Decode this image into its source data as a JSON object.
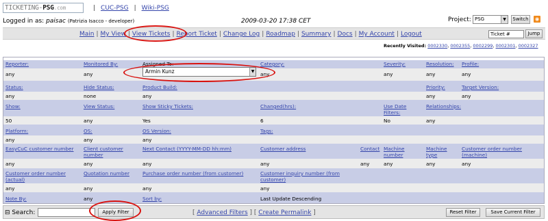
{
  "header": {
    "logo": {
      "prefix": "TICKETING-",
      "brand": "PSG",
      "suffix": ".com"
    },
    "top_links": [
      "CUC-PSG",
      "Wiki-PSG"
    ],
    "logged_in_label": "Logged in as:",
    "user": "paisac",
    "user_detail": "(Patrizia Isacco - developer)",
    "datetime": "2009-03-20 17:38 CET",
    "project_label": "Project:",
    "project_value": "PSG",
    "switch_label": "Switch"
  },
  "nav": {
    "items": [
      "Main",
      "My View",
      "View Tickets",
      "Report Ticket",
      "Change Log",
      "Roadmap",
      "Summary",
      "Docs",
      "My Account",
      "Logout"
    ],
    "ticket_placeholder": "Ticket #",
    "jump_label": "Jump"
  },
  "recent": {
    "label": "Recently Visited:",
    "items": [
      "0002330",
      "0002355",
      "0002299",
      "0002301",
      "0002327"
    ]
  },
  "filters": {
    "r1h": [
      "Reporter:",
      "Monitored By:",
      "Assigned To:",
      "Category:",
      "Severity:",
      "Resolution:",
      "Profile:"
    ],
    "r1v": [
      "any",
      "any",
      "any",
      "any",
      "any",
      "any"
    ],
    "assigned_value": "Armin Kunz",
    "r2h": [
      "Status:",
      "Hide Status:",
      "Product Build:",
      "Priority:",
      "Target Version:"
    ],
    "r2v": [
      "any",
      "none",
      "any",
      "any",
      "any"
    ],
    "r3h": [
      "Show:",
      "View Status:",
      "Show Sticky Tickets:",
      "Changed(hrs):",
      "Use Date Filters:",
      "Relationships:"
    ],
    "r3v": [
      "50",
      "any",
      "Yes",
      "6",
      "No",
      "any"
    ],
    "r4h": [
      "Platform:",
      "OS:",
      "OS Version:",
      "Tags:"
    ],
    "r4v": [
      "any",
      "any",
      "any"
    ],
    "r5h": [
      "EasyCuC customer number",
      "Client customer number",
      "Next Contact (YYYY-MM-DD hh:mm)",
      "Customer address",
      "Contact",
      "Machine number",
      "Machine type",
      "Customer order number (machine)"
    ],
    "r5v": [
      "any",
      "any",
      "any",
      "any",
      "any",
      "any",
      "any",
      "any"
    ],
    "r6h": [
      "Customer order number (actual)",
      "Quotation number",
      "Purchase order number (from customer)",
      "Customer inquiry number (from customer)"
    ],
    "r6v": [
      "any",
      "any",
      "any",
      "any"
    ],
    "r7h": [
      "Note By:",
      "Sort by:"
    ],
    "r7v": [
      "any",
      "Last Update Descending"
    ]
  },
  "bottom": {
    "search_label": "Search:",
    "apply_label": "Apply Filter",
    "advanced_label": "Advanced Filters",
    "permalink_label": "Create Permalink",
    "reset_label": "Reset Filter",
    "save_label": "Save Current Filter"
  },
  "annotation_color": "#d8120f"
}
